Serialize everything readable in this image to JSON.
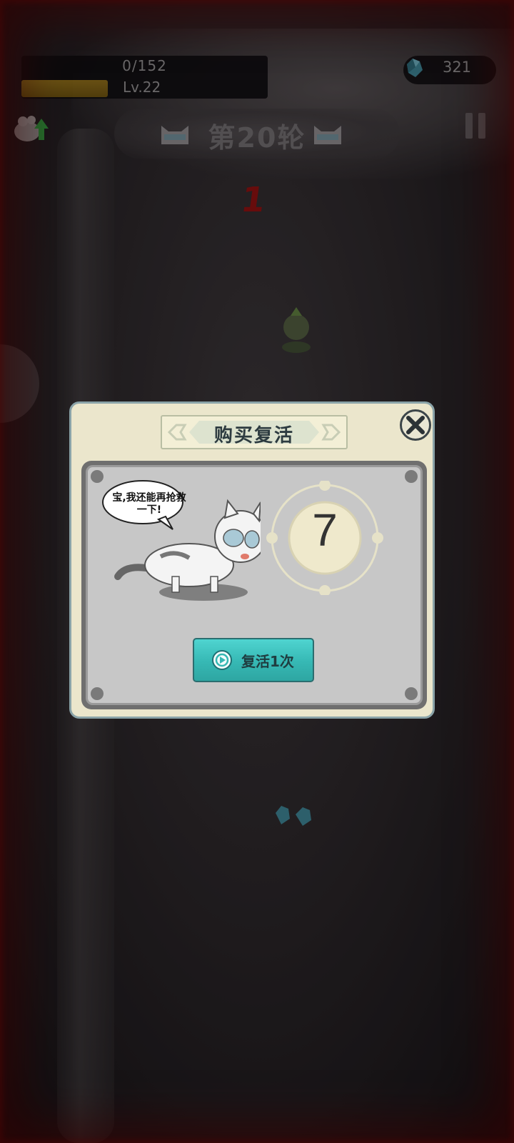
{
  "hud": {
    "xp_text": "0/152",
    "xp_progress": 0.35,
    "level_text": "Lv.22",
    "gem_count": "321",
    "round_title": "第20轮",
    "damage_number": "1"
  },
  "dialog": {
    "title": "购买复活",
    "speech_bubble": "宝,我还能再抢救一下!",
    "countdown": "7",
    "revive_button_label": "复活1次"
  },
  "colors": {
    "accent_teal": "#36b8b4",
    "dialog_bg": "#ebe6cc",
    "damage_red": "#8a1010"
  },
  "icons": [
    "upgrade-icon",
    "gem-icon",
    "pause-icon",
    "close-icon",
    "play-icon",
    "cat-head-icon"
  ]
}
